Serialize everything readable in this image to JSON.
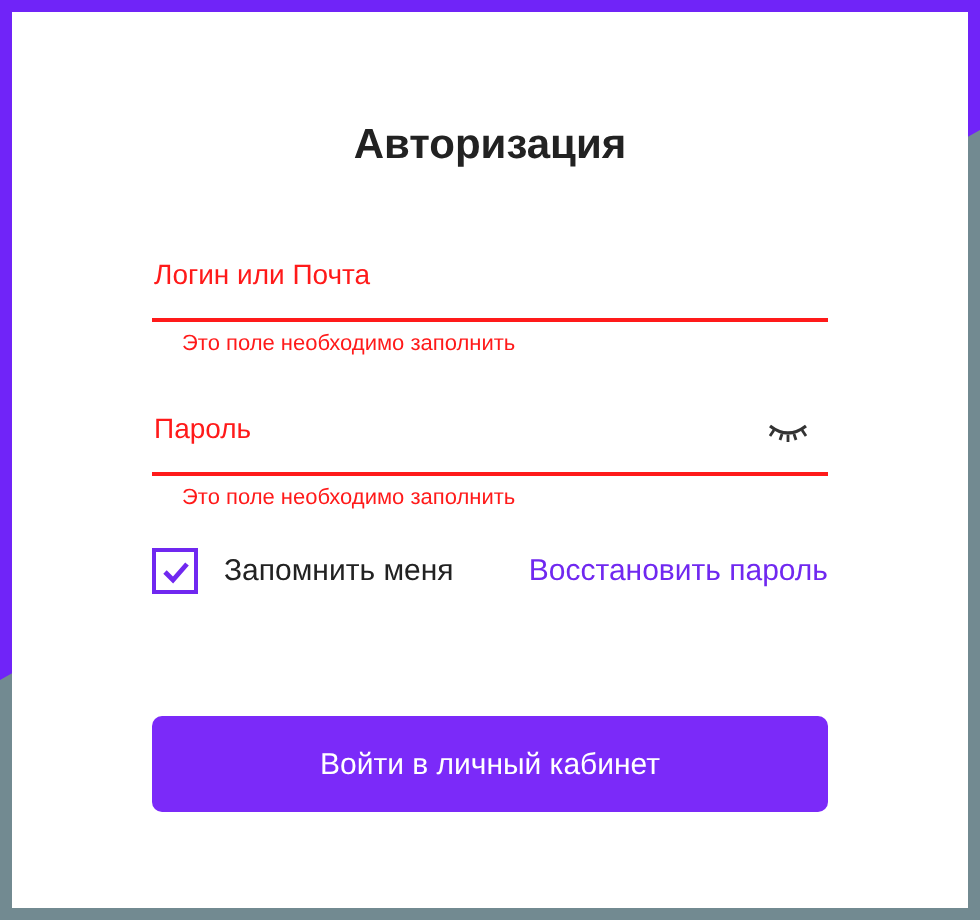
{
  "title": "Авторизация",
  "fields": [
    {
      "kind": "text",
      "placeholder": "Логин или Почта",
      "invalid": true,
      "error": "Это поле необходимо заполнить"
    },
    {
      "kind": "password",
      "placeholder": "Пароль",
      "invalid": true,
      "error": "Это поле необходимо заполнить"
    }
  ],
  "remember": {
    "label": "Запомнить меня",
    "checked": true
  },
  "restore_link": "Восстановить пароль",
  "submit": "Войти в личный кабинет"
}
